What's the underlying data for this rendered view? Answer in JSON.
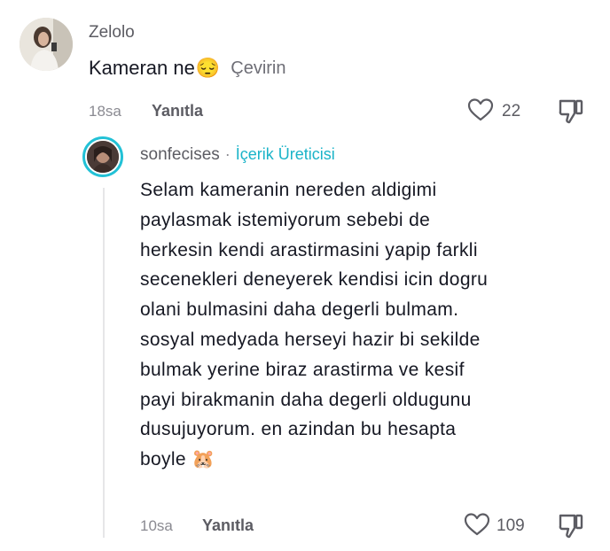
{
  "comment": {
    "username": "Zelolo",
    "text": "Kameran ne",
    "emoji": "😔",
    "translate_label": "Çevirin",
    "time": "18sa",
    "reply_label": "Yanıtla",
    "like_count": "22"
  },
  "reply": {
    "username": "sonfecises",
    "separator": "·",
    "badge": "İçerik Üreticisi",
    "text": "Selam kameranin nereden aldigimi\npaylasmak istemiyorum sebebi de\nherkesin kendi arastirmasini yapip farkli\nsecenekleri deneyerek kendisi icin dogru\nolani bulmasini daha degerli bulmam.\nsosyal medyada herseyi hazir bi sekilde\nbulmak yerine biraz arastirma ve kesif\npayi birakmanin daha degerli oldugunu\ndusujuyorum. en azindan bu hesapta\nboyle",
    "emoji": "🐹",
    "time": "10sa",
    "reply_label": "Yanıtla",
    "like_count": "109"
  },
  "icons": {
    "like": "heart-outline-icon",
    "dislike": "thumbs-down-icon"
  }
}
